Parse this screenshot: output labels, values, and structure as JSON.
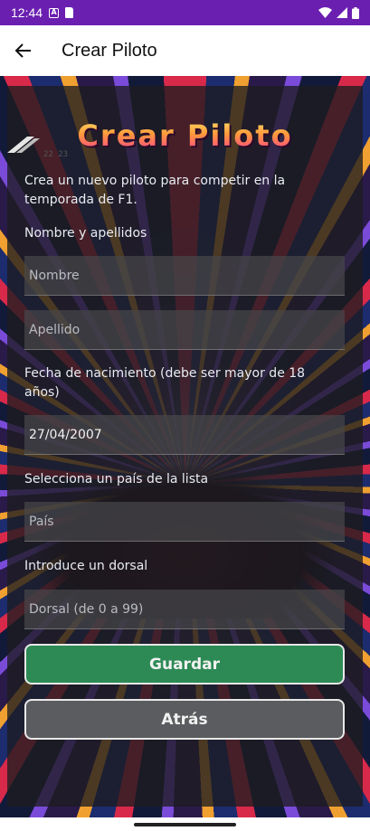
{
  "status_bar": {
    "time": "12:44",
    "a_icon": "A"
  },
  "app_bar": {
    "title": "Crear Piloto",
    "back_icon": "arrow-left"
  },
  "form": {
    "logo_title": "Crear Piloto",
    "description": "Crea un nuevo piloto para competir en la temporada de F1.",
    "name_label": "Nombre y apellidos",
    "name_placeholder": "Nombre",
    "surname_placeholder": "Apellido",
    "birth_label": "Fecha de nacimiento (debe ser mayor de 18 años)",
    "birth_value": "27/04/2007",
    "country_label": "Selecciona un país de la lista",
    "country_placeholder": "País",
    "number_label": "Introduce un dorsal",
    "number_placeholder": "Dorsal (de 0 a 99)",
    "save_label": "Guardar",
    "back_label": "Atrás"
  },
  "colors": {
    "status_bar": "#6a1fb0",
    "save_button": "#2d8a55",
    "back_button": "#5b5c5f"
  }
}
